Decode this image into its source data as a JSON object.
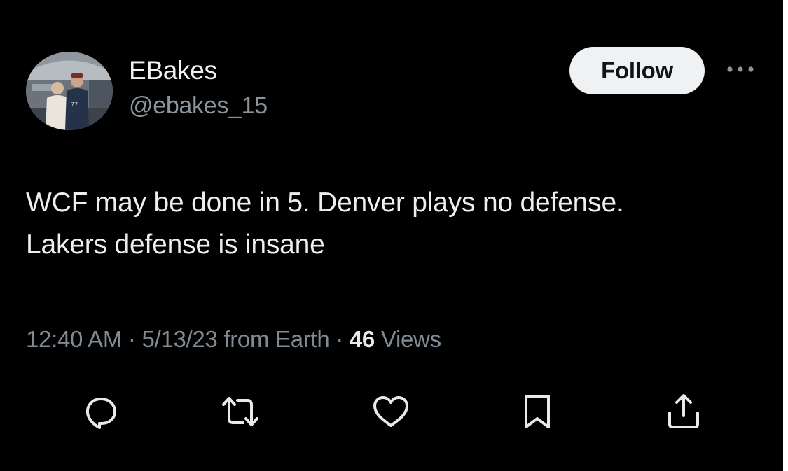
{
  "author": {
    "display_name": "EBakes",
    "handle": "@ebakes_15",
    "avatar_icon": "profile-photo"
  },
  "header": {
    "follow_label": "Follow",
    "more_icon": "ellipsis-icon"
  },
  "tweet": {
    "lines": [
      "WCF may be done in 5. Denver plays no defense.",
      "Lakers defense is insane"
    ]
  },
  "meta": {
    "time": "12:40 AM",
    "separator": "·",
    "date": "5/13/23",
    "source": "from Earth",
    "views_count": "46",
    "views_label": "Views"
  },
  "actions": [
    {
      "icon": "reply-icon"
    },
    {
      "icon": "retweet-icon"
    },
    {
      "icon": "like-icon"
    },
    {
      "icon": "bookmark-icon"
    },
    {
      "icon": "share-icon"
    }
  ],
  "colors": {
    "background": "#000000",
    "primary_text": "#e7e9ea",
    "secondary_text": "#8b949c",
    "follow_button_bg": "#eff1f2",
    "follow_button_text": "#0f1419"
  }
}
